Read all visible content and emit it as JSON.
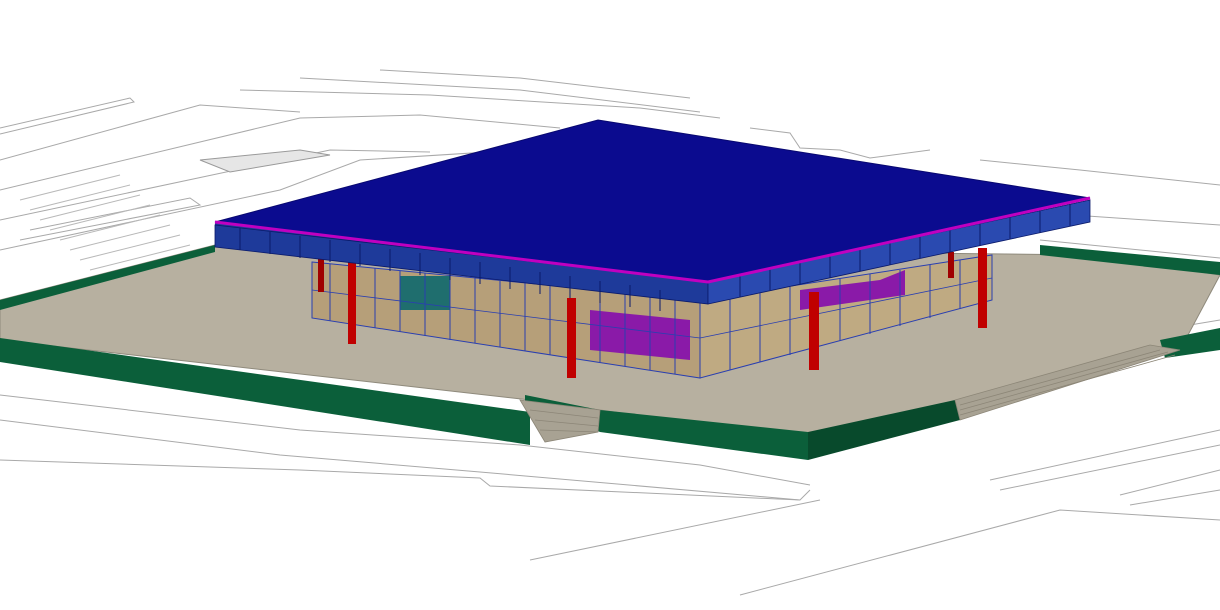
{
  "scene": {
    "description_visible_text": "",
    "colors": {
      "background": "#ffffff",
      "site_lines": "#a9a9a9",
      "plinth_floor": "#b7b0a0",
      "plinth_wall": "#0b5f3a",
      "plinth_wall_dark": "#084a2c",
      "roof_top": "#0b0b8f",
      "roof_fascia": "#1e3a9a",
      "roof_edge": "#c000c0",
      "glass": "#b59a6c",
      "glass_frame": "#2a3fb0",
      "column": "#c00000",
      "interior_purple": "#8a1aa8",
      "interior_teal": "#1f6e6e",
      "stairs": "#a8a293"
    }
  }
}
